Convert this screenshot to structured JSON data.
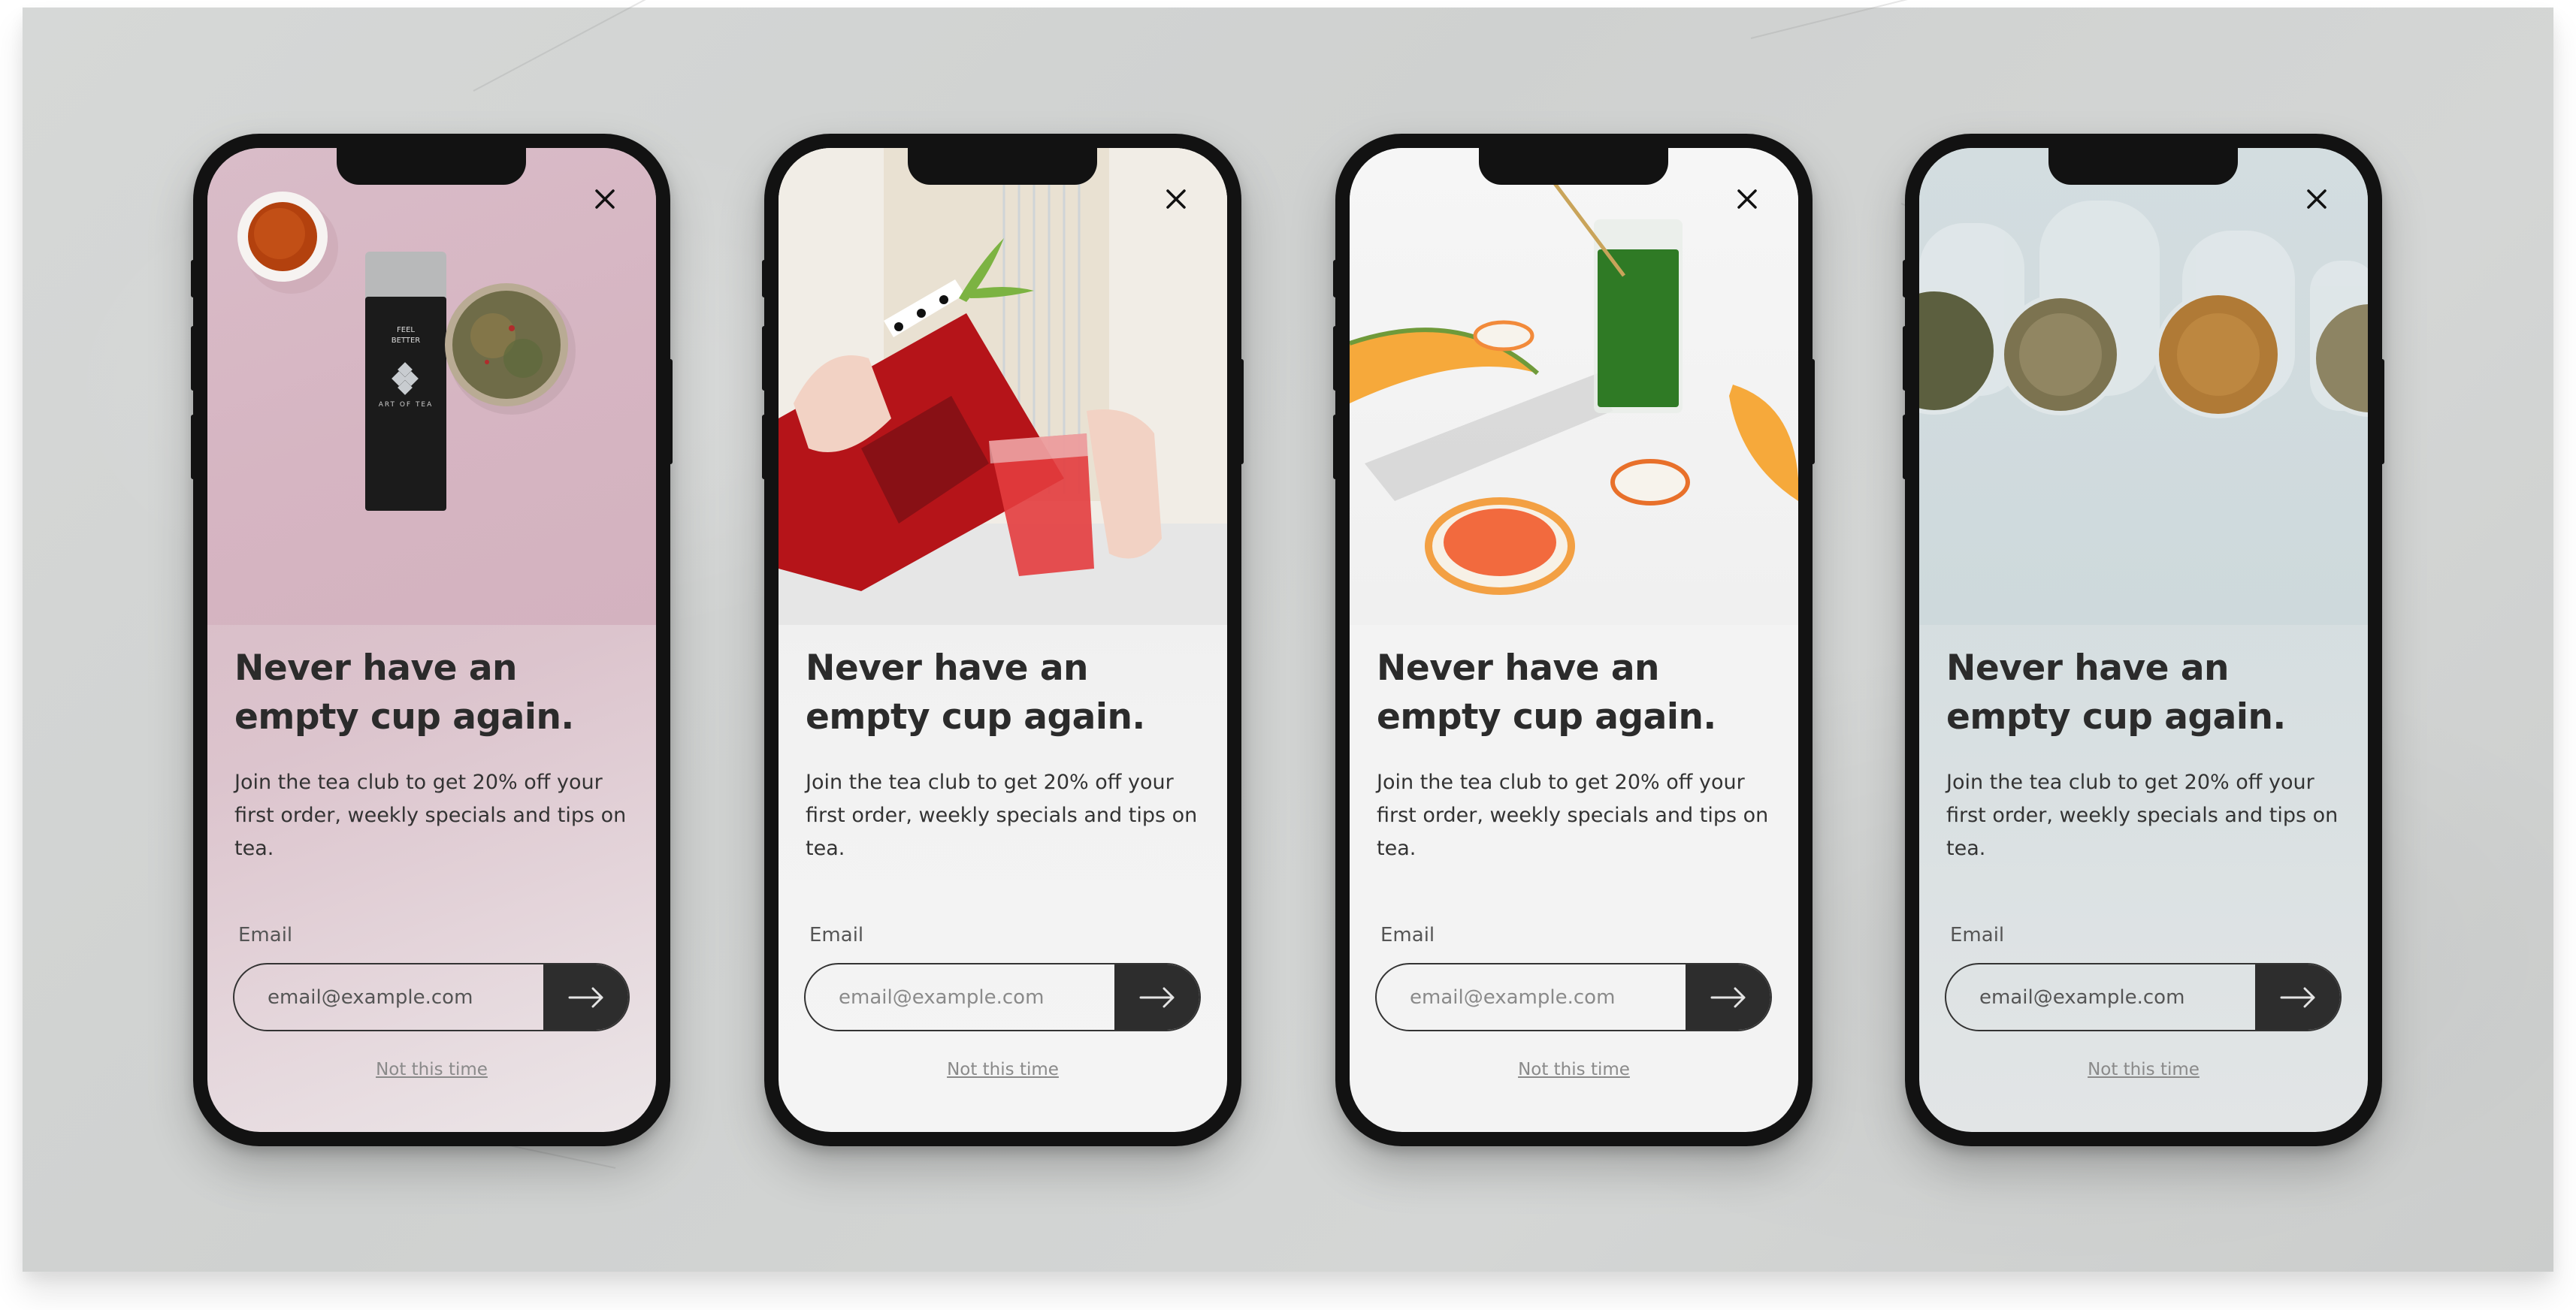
{
  "popups": [
    {
      "theme": "pink",
      "hero_description": "Tea tin labeled FEEL BETTER / ART OF TEA with a cup of tea and a bowl of loose leaf tea on pink background",
      "hero_tin_text_1": "FEEL",
      "hero_tin_text_2": "BETTER",
      "hero_tin_brand": "ART OF TEA",
      "headline_line1": "Never have an",
      "headline_line2": "empty cup again.",
      "body": "Join the tea club to get 20% off your first order, weekly specials and tips on tea.",
      "email_label": "Email",
      "email_placeholder": "email@example.com",
      "submit_icon": "arrow-right-icon",
      "dismiss_label": "Not this time",
      "close_icon": "close-icon",
      "accent_color": "#2d2d2d"
    },
    {
      "theme": "white",
      "hero_description": "Hands pouring red iced tea from a glass pitcher with mint into a glass",
      "headline_line1": "Never have an",
      "headline_line2": "empty cup again.",
      "body": "Join the tea club to get 20% off your first order, weekly specials and tips on tea.",
      "email_label": "Email",
      "email_placeholder": "email@example.com",
      "submit_icon": "arrow-right-icon",
      "dismiss_label": "Not this time",
      "close_icon": "close-icon",
      "accent_color": "#2d2d2d"
    },
    {
      "theme": "fruit",
      "hero_description": "Glass of green matcha drink with gold straw surrounded by melon and citrus slices",
      "headline_line1": "Never have an",
      "headline_line2": "empty cup again.",
      "body": "Join the tea club to get 20% off your first order, weekly specials and tips on tea.",
      "email_label": "Email",
      "email_placeholder": "email@example.com",
      "submit_icon": "arrow-right-icon",
      "dismiss_label": "Not this time",
      "close_icon": "close-icon",
      "accent_color": "#2d2d2d"
    },
    {
      "theme": "blue",
      "hero_description": "Row of glass jars filled with loose leaf teas viewed from above on pale blue background",
      "headline_line1": "Never have an",
      "headline_line2": "empty cup again.",
      "body": "Join the tea club to get 20% off your first order, weekly specials and tips on tea.",
      "email_label": "Email",
      "email_placeholder": "email@example.com",
      "submit_icon": "arrow-right-icon",
      "dismiss_label": "Not this time",
      "close_icon": "close-icon",
      "accent_color": "#2d2d2d"
    }
  ],
  "colors": {
    "background": "#d3d5d4",
    "phone_frame": "#121212",
    "headline": "#2b2b2b",
    "button": "#2d2d2d",
    "dismiss_link": "#8a8a8a"
  }
}
